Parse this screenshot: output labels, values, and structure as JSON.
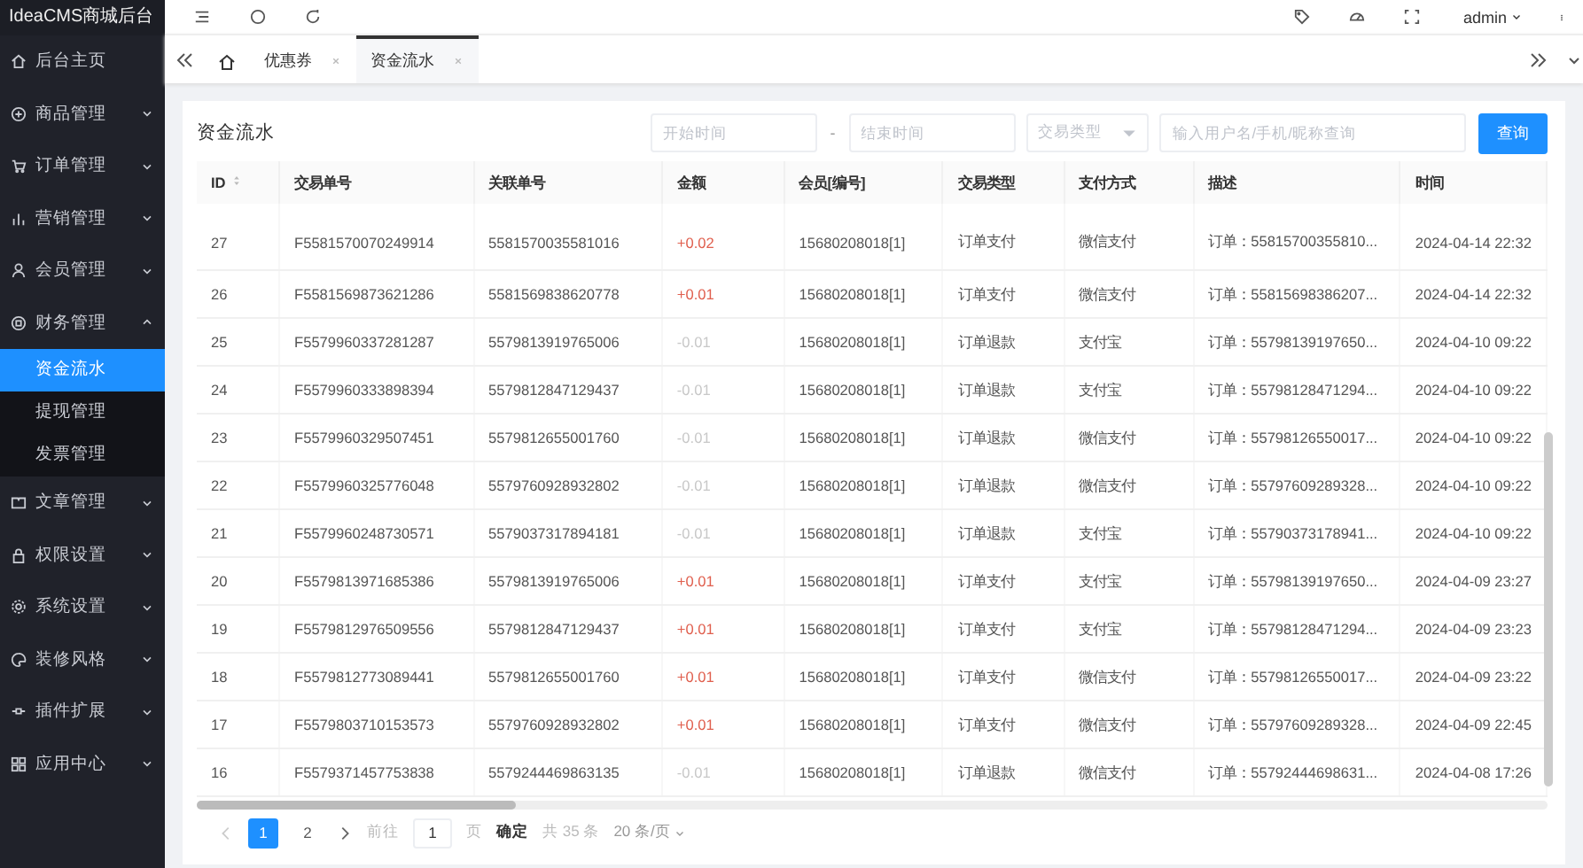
{
  "sidebar": {
    "logo": "IdeaCMS商城后台",
    "items": [
      {
        "label": "后台主页"
      },
      {
        "label": "商品管理",
        "expanded": false
      },
      {
        "label": "订单管理",
        "expanded": false
      },
      {
        "label": "营销管理",
        "expanded": false
      },
      {
        "label": "会员管理",
        "expanded": false
      },
      {
        "label": "财务管理",
        "expanded": true,
        "children": [
          {
            "label": "资金流水",
            "selected": true
          },
          {
            "label": "提现管理",
            "selected": false
          },
          {
            "label": "发票管理",
            "selected": false
          }
        ]
      },
      {
        "label": "文章管理",
        "expanded": false
      },
      {
        "label": "权限设置",
        "expanded": false
      },
      {
        "label": "系统设置",
        "expanded": false
      },
      {
        "label": "装修风格",
        "expanded": false
      },
      {
        "label": "插件扩展",
        "expanded": false
      },
      {
        "label": "应用中心",
        "expanded": false
      }
    ]
  },
  "header": {
    "user": "admin"
  },
  "tabs": [
    {
      "label": "优惠券",
      "selected": false
    },
    {
      "label": "资金流水",
      "selected": true
    }
  ],
  "card": {
    "title": "资金流水",
    "filters": {
      "start_placeholder": "开始时间",
      "separator": "-",
      "end_placeholder": "结束时间",
      "type_placeholder": "交易类型",
      "search_placeholder": "输入用户名/手机/昵称查询",
      "button": "查询"
    },
    "table": {
      "columns": [
        "ID",
        "交易单号",
        "关联单号",
        "金额",
        "会员[编号]",
        "交易类型",
        "支付方式",
        "描述",
        "时间"
      ],
      "rows": [
        {
          "kind": "credit",
          "cells": [
            "27",
            "F5581570070249914",
            "5581570035581016",
            "+0.02",
            "15680208018[1]",
            "订单支付",
            "微信支付",
            "订单：55815700355810...",
            "2024-04-14 22:32"
          ]
        },
        {
          "kind": "credit",
          "cells": [
            "26",
            "F5581569873621286",
            "5581569838620778",
            "+0.01",
            "15680208018[1]",
            "订单支付",
            "微信支付",
            "订单：55815698386207...",
            "2024-04-14 22:32"
          ]
        },
        {
          "kind": "debit",
          "cells": [
            "25",
            "F5579960337281287",
            "5579813919765006",
            "-0.01",
            "15680208018[1]",
            "订单退款",
            "支付宝",
            "订单：55798139197650...",
            "2024-04-10 09:22"
          ]
        },
        {
          "kind": "debit",
          "cells": [
            "24",
            "F5579960333898394",
            "5579812847129437",
            "-0.01",
            "15680208018[1]",
            "订单退款",
            "支付宝",
            "订单：55798128471294...",
            "2024-04-10 09:22"
          ]
        },
        {
          "kind": "debit",
          "cells": [
            "23",
            "F5579960329507451",
            "5579812655001760",
            "-0.01",
            "15680208018[1]",
            "订单退款",
            "微信支付",
            "订单：55798126550017...",
            "2024-04-10 09:22"
          ]
        },
        {
          "kind": "debit",
          "cells": [
            "22",
            "F5579960325776048",
            "5579760928932802",
            "-0.01",
            "15680208018[1]",
            "订单退款",
            "微信支付",
            "订单：55797609289328...",
            "2024-04-10 09:22"
          ]
        },
        {
          "kind": "debit",
          "cells": [
            "21",
            "F5579960248730571",
            "5579037317894181",
            "-0.01",
            "15680208018[1]",
            "订单退款",
            "支付宝",
            "订单：55790373178941...",
            "2024-04-10 09:22"
          ]
        },
        {
          "kind": "credit",
          "cells": [
            "20",
            "F5579813971685386",
            "5579813919765006",
            "+0.01",
            "15680208018[1]",
            "订单支付",
            "支付宝",
            "订单：55798139197650...",
            "2024-04-09 23:27"
          ]
        },
        {
          "kind": "credit",
          "cells": [
            "19",
            "F5579812976509556",
            "5579812847129437",
            "+0.01",
            "15680208018[1]",
            "订单支付",
            "支付宝",
            "订单：55798128471294...",
            "2024-04-09 23:23"
          ]
        },
        {
          "kind": "credit",
          "cells": [
            "18",
            "F5579812773089441",
            "5579812655001760",
            "+0.01",
            "15680208018[1]",
            "订单支付",
            "微信支付",
            "订单：55798126550017...",
            "2024-04-09 23:22"
          ]
        },
        {
          "kind": "credit",
          "cells": [
            "17",
            "F5579803710153573",
            "5579760928932802",
            "+0.01",
            "15680208018[1]",
            "订单支付",
            "微信支付",
            "订单：55797609289328...",
            "2024-04-09 22:45"
          ]
        },
        {
          "kind": "debit",
          "cells": [
            "16",
            "F5579371457753838",
            "5579244469863135",
            "-0.01",
            "15680208018[1]",
            "订单退款",
            "微信支付",
            "订单：55792444698631...",
            "2024-04-08 17:26"
          ]
        }
      ]
    },
    "pagination": {
      "pages": [
        {
          "label": "1",
          "selected": true
        },
        {
          "label": "2",
          "selected": false
        }
      ],
      "goto": "前往",
      "page_input": "1",
      "page_unit": "页",
      "confirm": "确定",
      "total": "共 35 条",
      "page_size": "20 条/页"
    }
  }
}
